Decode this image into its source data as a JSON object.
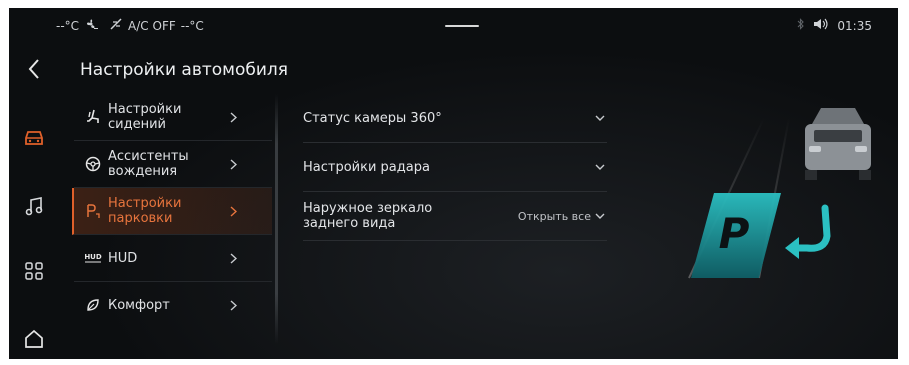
{
  "status_bar": {
    "left_temp": "--°C",
    "ac_status": "A/C OFF",
    "right_temp": "--°C",
    "time": "01:35"
  },
  "page": {
    "title": "Настройки автомобиля"
  },
  "menu": [
    {
      "label_line1": "Настройки",
      "label_line2": "сидений",
      "icon": "seat-icon",
      "active": false
    },
    {
      "label_line1": "Ассистенты",
      "label_line2": "вождения",
      "icon": "steering-wheel-icon",
      "active": false
    },
    {
      "label_line1": "Настройки",
      "label_line2": "парковки",
      "icon": "parking-icon",
      "active": true
    },
    {
      "label_line1": "HUD",
      "label_line2": "",
      "icon": "hud-icon",
      "active": false
    },
    {
      "label_line1": "Комфорт",
      "label_line2": "",
      "icon": "leaf-icon",
      "active": false
    }
  ],
  "settings": [
    {
      "label_line1": "Статус камеры 360°",
      "label_line2": "",
      "value": ""
    },
    {
      "label_line1": "Настройки радара",
      "label_line2": "",
      "value": ""
    },
    {
      "label_line1": "Наружное зеркало",
      "label_line2": "заднего вида",
      "value": "Открыть все"
    }
  ],
  "illustration": {
    "parking_letter": "P"
  },
  "hud_icon_text": "HUD",
  "colors": {
    "accent": "#e7743d",
    "teal": "#1fb6b9",
    "background": "#0c0e10"
  }
}
